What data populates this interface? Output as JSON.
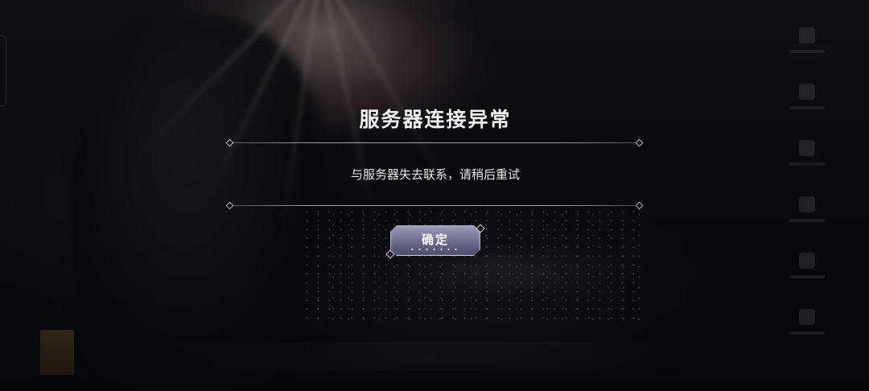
{
  "dialog": {
    "title": "服务器连接异常",
    "message": "与服务器失去联系，请稍后重试",
    "confirm_label": "确定"
  },
  "colors": {
    "dialog_text": "#f2f2f4",
    "button_top": "#9c9cb6",
    "button_bottom": "#4a4b6a",
    "divider": "#dcdce4"
  },
  "icons": {
    "divider_ornament": "diamond-icon",
    "button_ornament": "sparkle-icon"
  }
}
